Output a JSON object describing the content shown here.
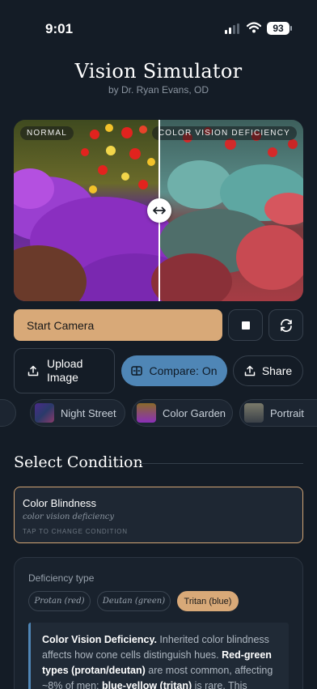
{
  "status_bar": {
    "time": "9:01",
    "battery": "93"
  },
  "header": {
    "title": "Vision Simulator",
    "subtitle": "by Dr. Ryan Evans, OD"
  },
  "compare_view": {
    "left_label": "NORMAL",
    "right_label": "COLOR VISION DEFICIENCY"
  },
  "controls": {
    "start_camera": "Start Camera",
    "upload_image": "Upload Image",
    "compare": "Compare: On",
    "share": "Share"
  },
  "samples": [
    {
      "label": "Night Street"
    },
    {
      "label": "Color Garden"
    },
    {
      "label": "Portrait"
    }
  ],
  "condition_section": {
    "title": "Select Condition",
    "selected_name": "Color Blindness",
    "selected_desc": "color vision deficiency",
    "hint": "TAP TO CHANGE CONDITION"
  },
  "deficiency": {
    "label": "Deficiency type",
    "options": [
      "Protan (red)",
      "Deutan (green)",
      "Tritan (blue)"
    ],
    "selected": "Tritan (blue)"
  },
  "info": {
    "heading": "Color Vision Deficiency.",
    "text1": " Inherited color blindness affects how cone cells distinguish hues. ",
    "bold1": "Red-green types (protan/deutan)",
    "text2": " are most common, affecting ~8% of men; ",
    "bold2": "blue-yellow (tritan)",
    "text3": " is rare. This simulates"
  },
  "colors": {
    "background": "#141c26",
    "accent": "#d8a978",
    "compare_active": "#4f86b6"
  },
  "icons": [
    "signal-icon",
    "wifi-icon",
    "battery-icon",
    "swap-horizontal-icon",
    "stop-icon",
    "switch-camera-icon",
    "upload-icon",
    "compare-icon",
    "share-icon"
  ]
}
